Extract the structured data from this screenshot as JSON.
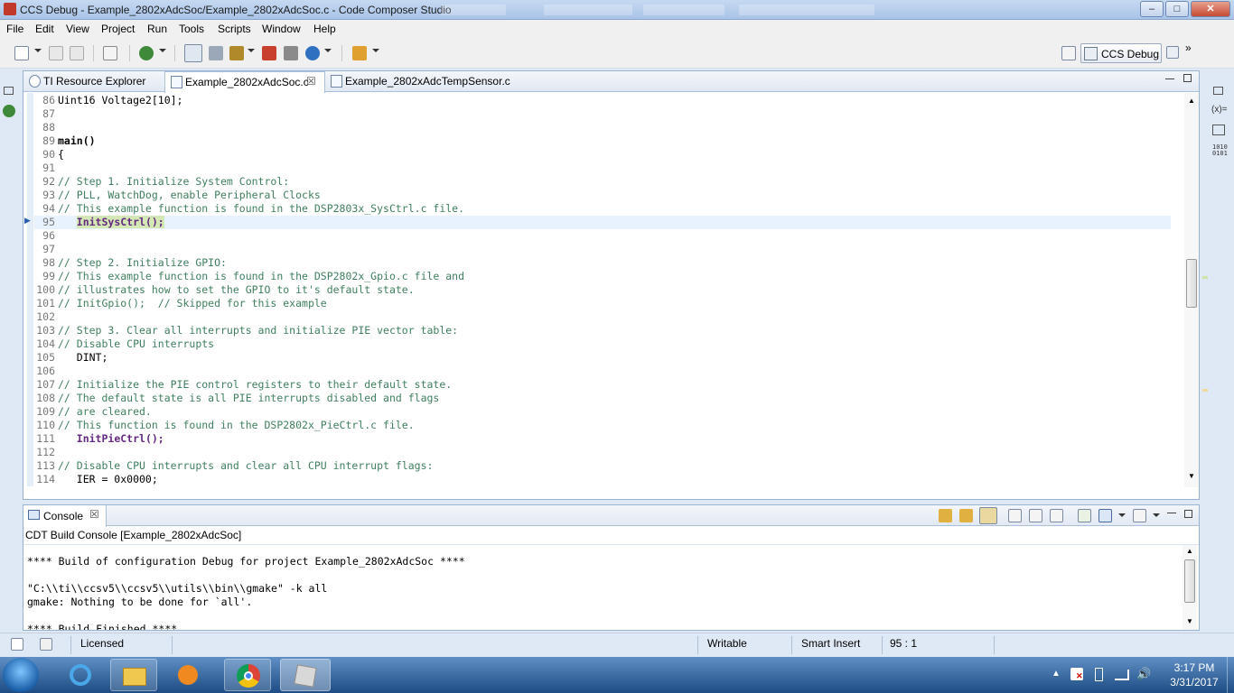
{
  "window": {
    "title": "CCS Debug - Example_2802xAdcSoc/Example_2802xAdcSoc.c - Code Composer Studio",
    "minimize": "–",
    "maximize": "□",
    "close": "✕"
  },
  "menu": [
    "File",
    "Edit",
    "View",
    "Project",
    "Run",
    "Tools",
    "Scripts",
    "Window",
    "Help"
  ],
  "perspective": {
    "label": "CCS Debug",
    "more": "»"
  },
  "editor_tabs": [
    {
      "label": "TI Resource Explorer"
    },
    {
      "label": "Example_2802xAdcSoc.c",
      "close": "☒"
    },
    {
      "label": "Example_2802xAdcTempSensor.c"
    }
  ],
  "code_lines": [
    {
      "n": "86",
      "text": "Uint16 Voltage2[10];",
      "kind": "normal"
    },
    {
      "n": "87",
      "text": "",
      "kind": "normal"
    },
    {
      "n": "88",
      "text": "",
      "kind": "normal"
    },
    {
      "n": "89",
      "text": "main()",
      "kind": "bold"
    },
    {
      "n": "90",
      "text": "{",
      "kind": "normal"
    },
    {
      "n": "91",
      "text": "",
      "kind": "normal"
    },
    {
      "n": "92",
      "text": "// Step 1. Initialize System Control:",
      "kind": "comment"
    },
    {
      "n": "93",
      "text": "// PLL, WatchDog, enable Peripheral Clocks",
      "kind": "comment"
    },
    {
      "n": "94",
      "text": "// This example function is found in the DSP2803x_SysCtrl.c file.",
      "kind": "comment"
    },
    {
      "n": "95",
      "text": "   InitSysCtrl();",
      "kind": "funcsel"
    },
    {
      "n": "96",
      "text": "",
      "kind": "normal"
    },
    {
      "n": "97",
      "text": "",
      "kind": "normal"
    },
    {
      "n": "98",
      "text": "// Step 2. Initialize GPIO:",
      "kind": "comment"
    },
    {
      "n": "99",
      "text": "// This example function is found in the DSP2802x_Gpio.c file and",
      "kind": "comment"
    },
    {
      "n": "100",
      "text": "// illustrates how to set the GPIO to it's default state.",
      "kind": "comment"
    },
    {
      "n": "101",
      "text": "// InitGpio();  // Skipped for this example",
      "kind": "comment"
    },
    {
      "n": "102",
      "text": "",
      "kind": "normal"
    },
    {
      "n": "103",
      "text": "// Step 3. Clear all interrupts and initialize PIE vector table:",
      "kind": "comment"
    },
    {
      "n": "104",
      "text": "// Disable CPU interrupts",
      "kind": "comment"
    },
    {
      "n": "105",
      "text": "   DINT;",
      "kind": "normal"
    },
    {
      "n": "106",
      "text": "",
      "kind": "normal"
    },
    {
      "n": "107",
      "text": "// Initialize the PIE control registers to their default state.",
      "kind": "comment"
    },
    {
      "n": "108",
      "text": "// The default state is all PIE interrupts disabled and flags",
      "kind": "comment"
    },
    {
      "n": "109",
      "text": "// are cleared.",
      "kind": "comment"
    },
    {
      "n": "110",
      "text": "// This function is found in the DSP2802x_PieCtrl.c file.",
      "kind": "comment"
    },
    {
      "n": "111",
      "text": "   InitPieCtrl();",
      "kind": "func"
    },
    {
      "n": "112",
      "text": "",
      "kind": "normal"
    },
    {
      "n": "113",
      "text": "// Disable CPU interrupts and clear all CPU interrupt flags:",
      "kind": "comment"
    },
    {
      "n": "114",
      "text": "   IER = 0x0000;",
      "kind": "normal"
    }
  ],
  "current_line": "95",
  "console": {
    "tab_label": "Console",
    "tab_close": "☒",
    "subtitle": "CDT Build Console [Example_2802xAdcSoc]",
    "lines": [
      "",
      "**** Build of configuration Debug for project Example_2802xAdcSoc ****",
      "",
      "\"C:\\\\ti\\\\ccsv5\\\\ccsv5\\\\utils\\\\bin\\\\gmake\" -k all",
      "gmake: Nothing to be done for `all'.",
      "",
      "**** Build Finished ****"
    ]
  },
  "status": {
    "license": "Licensed",
    "mode": "Writable",
    "insert": "Smart Insert",
    "position": "95 : 1"
  },
  "taskbar": {
    "time": "3:17 PM",
    "date": "3/31/2017"
  },
  "icons": {
    "app": "ccs-app-icon",
    "start": "windows-start-icon",
    "ie": "internet-explorer-icon",
    "explorer": "file-explorer-icon",
    "media": "media-player-icon",
    "chrome": "chrome-icon",
    "vbox": "virtualbox-icon"
  }
}
